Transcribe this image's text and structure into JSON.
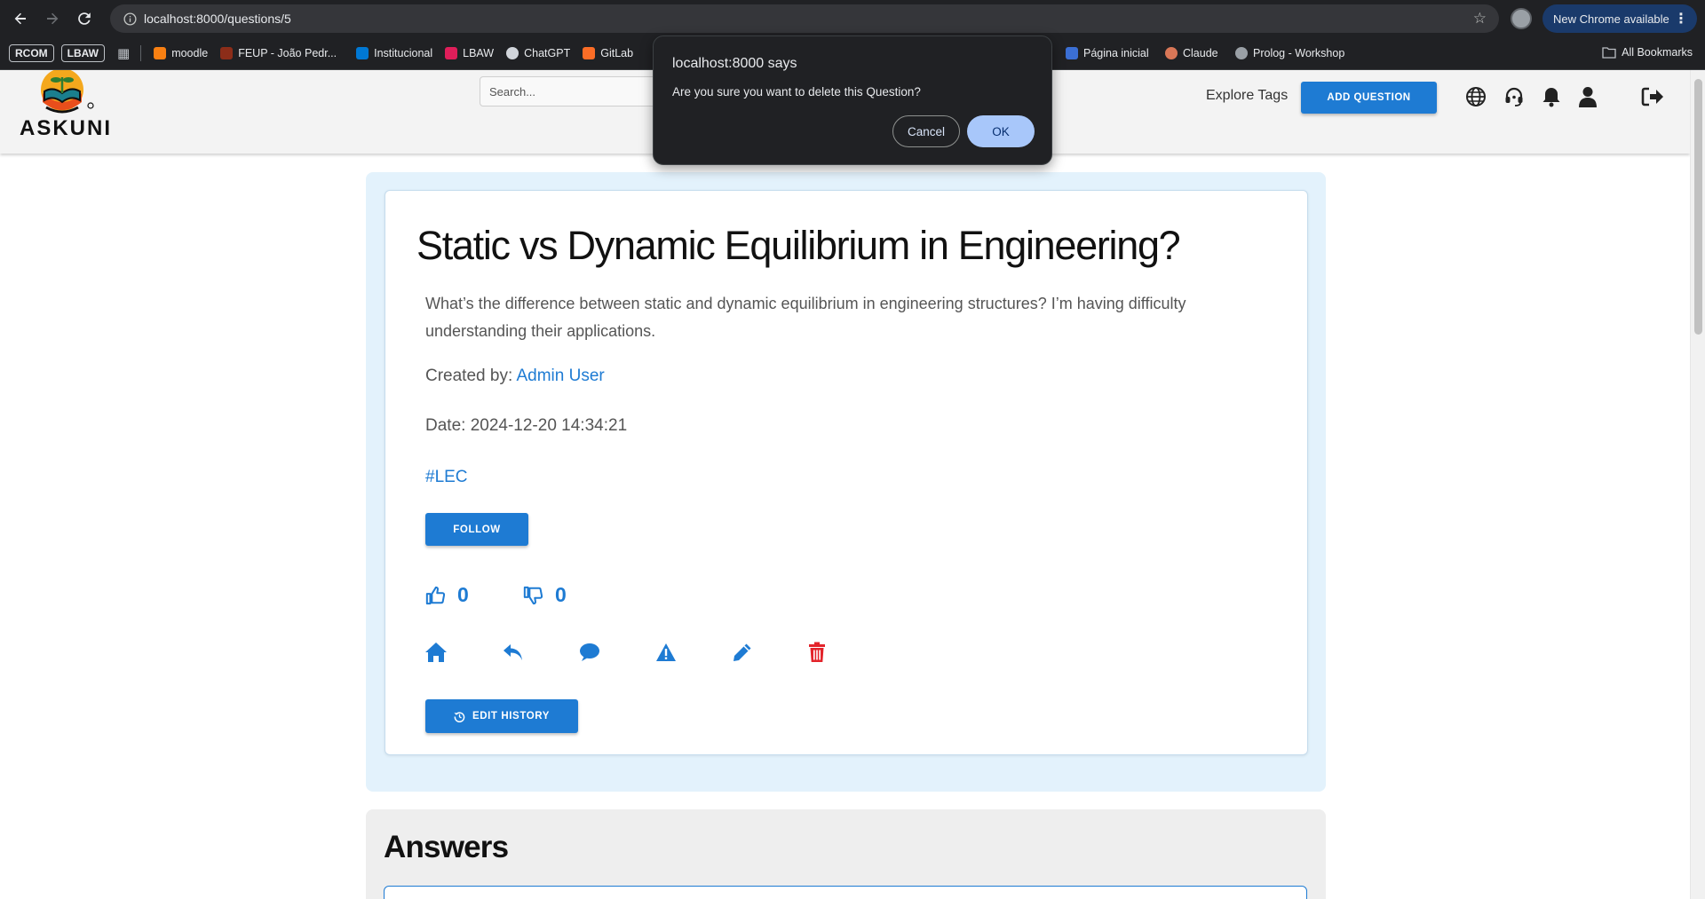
{
  "browser": {
    "url": "localhost:8000/questions/5",
    "new_chrome_label": "New Chrome available",
    "bookmarks": [
      {
        "label": "moodle",
        "color": "#f98012"
      },
      {
        "label": "FEUP - João Pedr...",
        "color": "#8c2d19"
      },
      {
        "label": "Institucional",
        "color": "#0078d4"
      },
      {
        "label": "LBAW",
        "color": "#e01e5a"
      },
      {
        "label": "ChatGPT",
        "color": "#d1d5db"
      },
      {
        "label": "GitLab",
        "color": "#fc6d26"
      },
      {
        "label": "Página inicial",
        "color": "#3b6fd4"
      },
      {
        "label": "Claude",
        "color": "#d97757"
      },
      {
        "label": "Prolog - Workshop",
        "color": "#9aa0a6"
      }
    ],
    "badges": [
      "RCOM",
      "LBAW"
    ],
    "all_bookmarks": "All Bookmarks"
  },
  "header": {
    "logo_text": "ASKUNI",
    "search_placeholder": "Search...",
    "explore_tags": "Explore Tags",
    "add_question": "ADD QUESTION"
  },
  "question": {
    "title": "Static vs Dynamic Equilibrium in Engineering?",
    "body": "What’s the difference between static and dynamic equilibrium in engineering structures? I’m having difficulty understanding their applications.",
    "created_by_label": "Created by:",
    "author": "Admin User",
    "date_label": "Date:",
    "date": "2024-12-20 14:34:21",
    "tag": "#LEC",
    "follow": "FOLLOW",
    "upvotes": "0",
    "downvotes": "0",
    "edit_history": "EDIT HISTORY"
  },
  "answers": {
    "title": "Answers"
  },
  "dialog": {
    "title": "localhost:8000 says",
    "message": "Are you sure you want to delete this Question?",
    "cancel": "Cancel",
    "ok": "OK"
  },
  "colors": {
    "primary": "#1e7bd3",
    "danger": "#e3242b",
    "card_bg": "#e3f2fc"
  }
}
